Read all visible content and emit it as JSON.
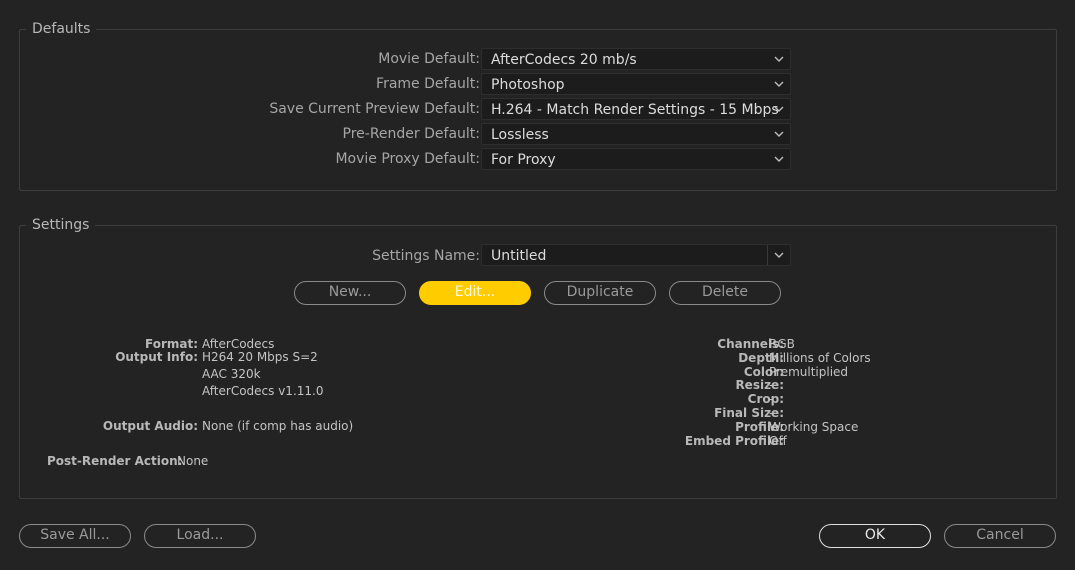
{
  "defaults": {
    "title": "Defaults",
    "rows": [
      {
        "label": "Movie Default:",
        "value": "AfterCodecs 20 mb/s"
      },
      {
        "label": "Frame Default:",
        "value": "Photoshop"
      },
      {
        "label": "Save Current Preview Default:",
        "value": "H.264 - Match Render Settings - 15 Mbps"
      },
      {
        "label": "Pre-Render Default:",
        "value": "Lossless"
      },
      {
        "label": "Movie Proxy Default:",
        "value": "For Proxy"
      }
    ]
  },
  "settings": {
    "title": "Settings",
    "name_label": "Settings Name:",
    "name_value": "Untitled",
    "buttons": {
      "new": "New...",
      "edit": "Edit...",
      "duplicate": "Duplicate",
      "delete": "Delete"
    },
    "left": {
      "format_label": "Format:",
      "format_value": "AfterCodecs",
      "output_info_label": "Output Info:",
      "output_info_lines": [
        "H264 20 Mbps S=2",
        "AAC 320k",
        "AfterCodecs v1.11.0"
      ],
      "output_audio_label": "Output Audio:",
      "output_audio_value": "None (if comp has audio)",
      "post_render_label": "Post-Render Action:",
      "post_render_value": "None"
    },
    "right": [
      {
        "label": "Channels:",
        "value": "RGB"
      },
      {
        "label": "Depth:",
        "value": "Millions of Colors"
      },
      {
        "label": "Color:",
        "value": "Premultiplied"
      },
      {
        "label": "Resize:",
        "value": "-"
      },
      {
        "label": "Crop:",
        "value": "-"
      },
      {
        "label": "Final Size:",
        "value": "-"
      },
      {
        "label": "Profile:",
        "value": "Working Space"
      },
      {
        "label": "Embed Profile:",
        "value": "Off"
      }
    ]
  },
  "footer": {
    "save_all": "Save All...",
    "load": "Load...",
    "ok": "OK",
    "cancel": "Cancel"
  },
  "colors": {
    "accent": "#ffcc00",
    "background": "#232323"
  }
}
